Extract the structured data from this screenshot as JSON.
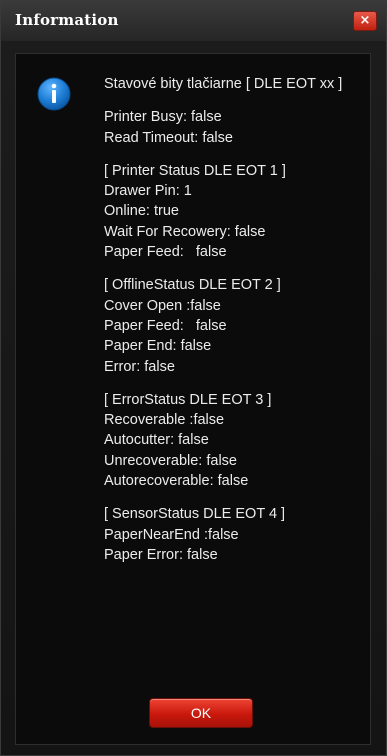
{
  "window": {
    "title": "Information",
    "close_glyph": "×"
  },
  "icon": "info-icon",
  "message": {
    "header": "Stavové bity tlačiarne [ DLE EOT xx ]",
    "general": [
      "Printer Busy: false",
      "Read Timeout: false"
    ],
    "printer_status": [
      "[ Printer Status DLE EOT 1 ]",
      "Drawer Pin: 1",
      "Online: true",
      "Wait For Recowery: false",
      "Paper Feed:   false"
    ],
    "offline_status": [
      "[ OfflineStatus DLE EOT 2 ]",
      "Cover Open :false",
      "Paper Feed:   false",
      "Paper End: false",
      "Error: false"
    ],
    "error_status": [
      "[ ErrorStatus DLE EOT 3 ]",
      "Recoverable :false",
      "Autocutter: false",
      "Unrecoverable: false",
      "Autorecoverable: false"
    ],
    "sensor_status": [
      "[ SensorStatus DLE EOT 4 ]",
      "PaperNearEnd :false",
      "Paper Error: false"
    ]
  },
  "buttons": {
    "ok_label": "OK"
  },
  "colors": {
    "accent": "#d0200f",
    "icon_blue": "#1e7fd6",
    "text": "#ececec",
    "background": "#0b0b0b"
  }
}
